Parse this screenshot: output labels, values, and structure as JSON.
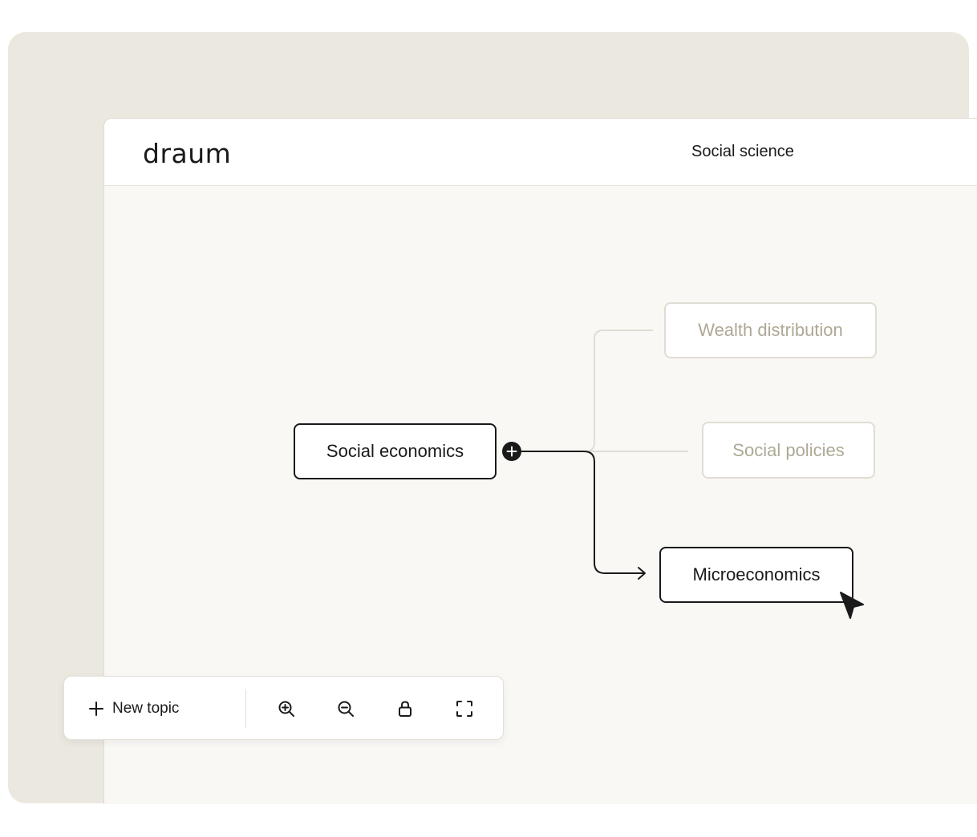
{
  "app": {
    "logo": "draum",
    "title": "Social science"
  },
  "mindmap": {
    "root": {
      "label": "Social economics",
      "state": "active"
    },
    "children": [
      {
        "label": "Wealth distribution",
        "state": "faded"
      },
      {
        "label": "Social policies",
        "state": "faded"
      },
      {
        "label": "Microeconomics",
        "state": "active"
      }
    ],
    "add_handle_icon": "plus-circle-icon"
  },
  "toolbar": {
    "new_topic_label": "New topic",
    "new_topic_icon": "plus-icon",
    "icons": [
      "zoom-in-icon",
      "zoom-out-icon",
      "lock-icon",
      "fullscreen-icon"
    ]
  },
  "colors": {
    "outer_bg": "#ebe8e0",
    "canvas_bg": "#f9f8f5",
    "active": "#1a1a1a",
    "faded_border": "#e0ddd3",
    "faded_text": "#aea894"
  }
}
